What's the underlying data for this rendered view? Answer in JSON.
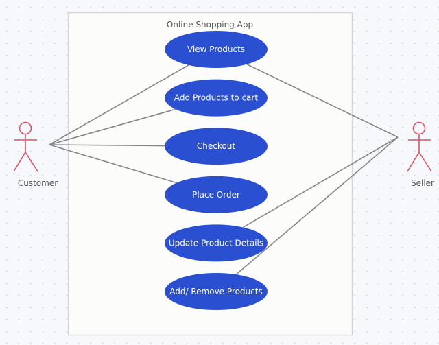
{
  "diagram": {
    "type": "use-case",
    "system": {
      "title": "Online Shopping App"
    },
    "actors": [
      {
        "id": "customer",
        "label": "Customer",
        "icon": "stick-figure-icon"
      },
      {
        "id": "seller",
        "label": "Seller",
        "icon": "stick-figure-icon"
      }
    ],
    "use_cases": [
      {
        "id": "view",
        "label": "View Products"
      },
      {
        "id": "cart",
        "label": "Add Products to cart"
      },
      {
        "id": "checkout",
        "label": "Checkout"
      },
      {
        "id": "order",
        "label": "Place Order"
      },
      {
        "id": "update",
        "label": "Update Product Details"
      },
      {
        "id": "addremove",
        "label": "Add/ Remove Products"
      }
    ],
    "associations": [
      {
        "from": "customer",
        "to": "view"
      },
      {
        "from": "customer",
        "to": "cart"
      },
      {
        "from": "customer",
        "to": "checkout"
      },
      {
        "from": "customer",
        "to": "order"
      },
      {
        "from": "seller",
        "to": "view"
      },
      {
        "from": "seller",
        "to": "update"
      },
      {
        "from": "seller",
        "to": "addremove"
      }
    ],
    "colors": {
      "use_case_fill": "#2a4fd1",
      "actor_stroke": "#e0505f",
      "line": "#868686",
      "system_fill": "#fcfcfb",
      "system_border": "#d6d6d6"
    }
  }
}
